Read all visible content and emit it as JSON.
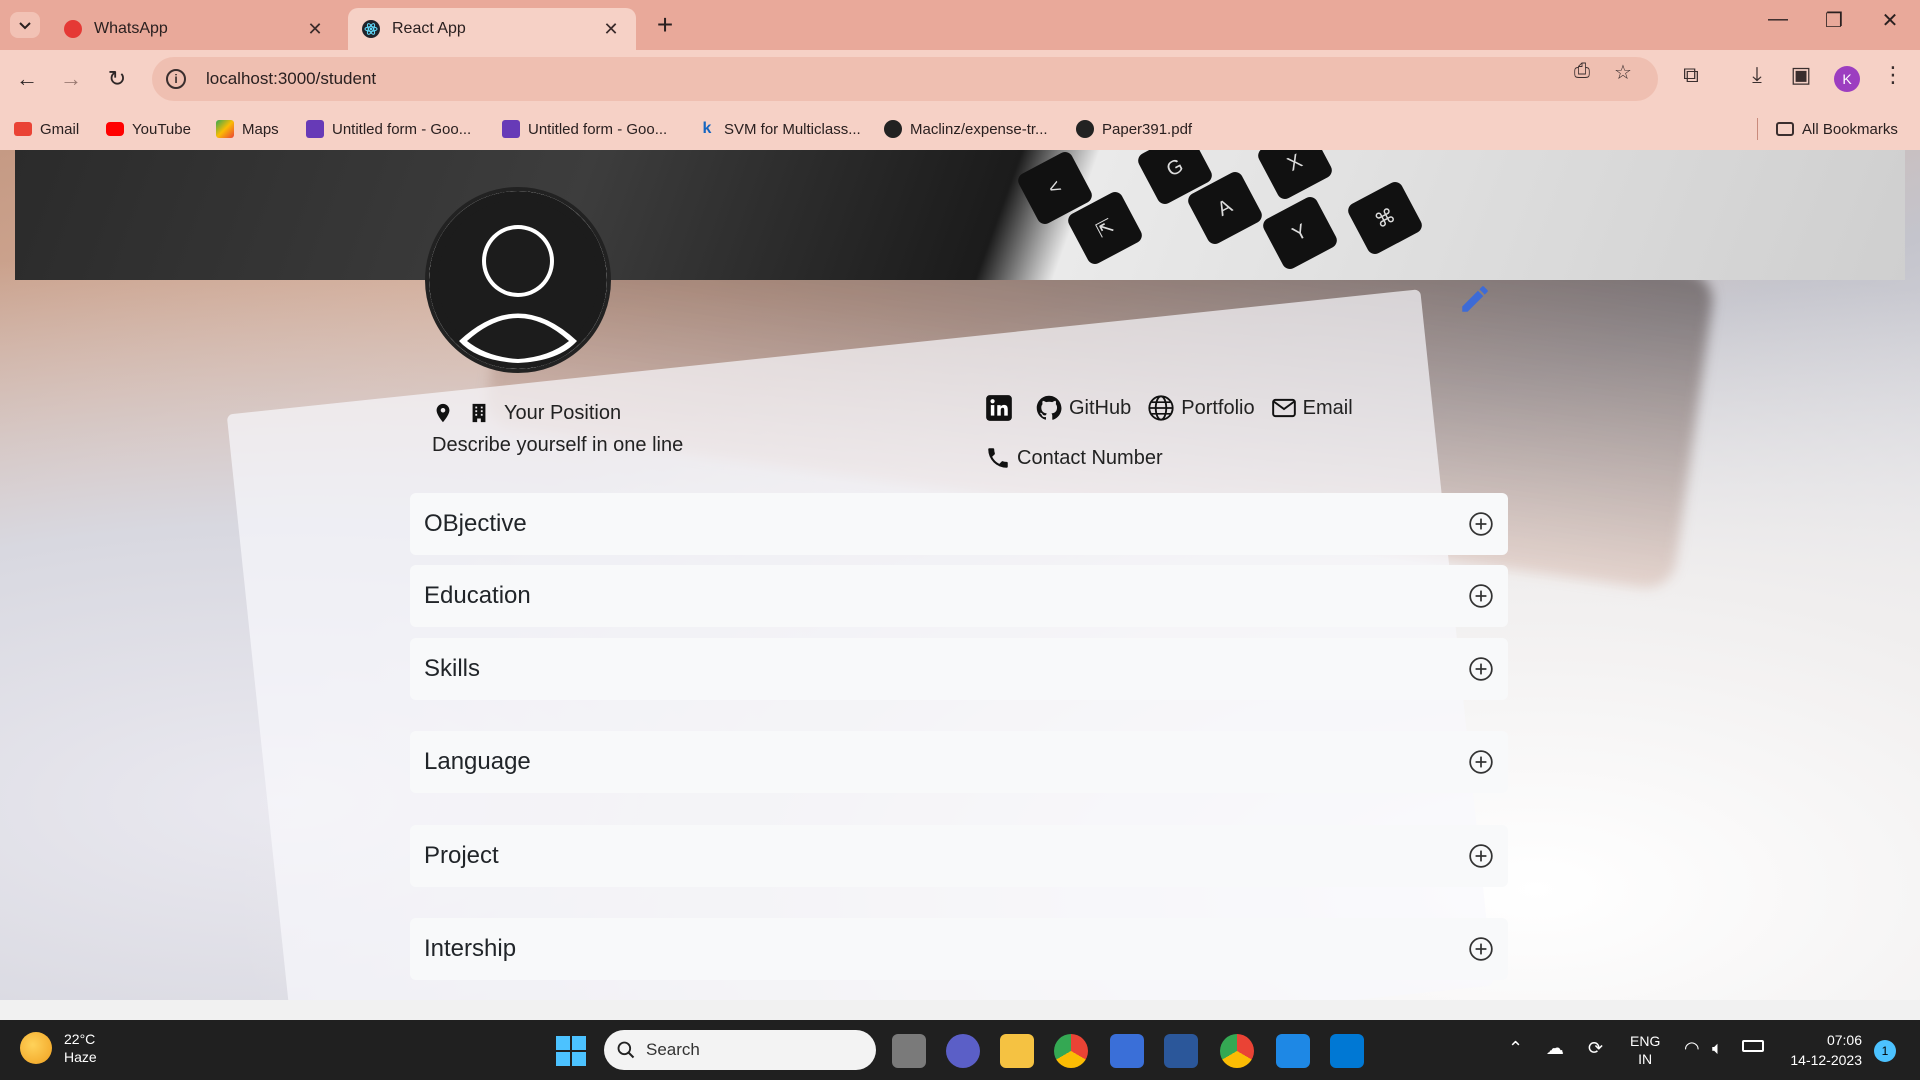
{
  "browser": {
    "tabs": [
      {
        "title": "WhatsApp",
        "active": false,
        "favicon_color": "#e53935"
      },
      {
        "title": "React App",
        "active": true,
        "favicon_color": "#20232a"
      }
    ],
    "url": "localhost:3000/student",
    "profile_initial": "K",
    "bookmarks": [
      {
        "label": "Gmail",
        "icon": "gmail-icon",
        "color": "#ea4335"
      },
      {
        "label": "YouTube",
        "icon": "youtube-icon",
        "color": "#ff0000"
      },
      {
        "label": "Maps",
        "icon": "maps-icon",
        "color": "#34a853"
      },
      {
        "label": "Untitled form - Goo...",
        "icon": "forms-icon",
        "color": "#673ab7"
      },
      {
        "label": "Untitled form - Goo...",
        "icon": "forms-icon",
        "color": "#673ab7"
      },
      {
        "label": "SVM for Multiclass...",
        "icon": "k-icon",
        "color": "#1565c0"
      },
      {
        "label": "Maclinz/expense-tr...",
        "icon": "github-icon",
        "color": "#222222"
      },
      {
        "label": "Paper391.pdf",
        "icon": "globe-icon",
        "color": "#222222"
      }
    ],
    "all_bookmarks_label": "All Bookmarks"
  },
  "profile": {
    "position": "Your Position",
    "tagline": "Describe yourself in one line",
    "links": {
      "github": "GitHub",
      "portfolio": "Portfolio",
      "email": "Email",
      "contact": "Contact Number"
    }
  },
  "sections": [
    {
      "title": "OBjective"
    },
    {
      "title": "Education"
    },
    {
      "title": "Skills"
    },
    {
      "title": "Language"
    },
    {
      "title": "Project"
    },
    {
      "title": "Intership"
    }
  ],
  "taskbar": {
    "weather_temp": "22°C",
    "weather_desc": "Haze",
    "search_placeholder": "Search",
    "lang_1": "ENG",
    "lang_2": "IN",
    "time": "07:06",
    "date": "14-12-2023",
    "notification_count": "1"
  },
  "colors": {
    "tab_bar": "#e9a99a",
    "toolbar": "#f6d1c6",
    "accordion_bg": "#f8f9fa",
    "taskbar": "#202020",
    "accent_blue": "#4cc2ff"
  }
}
